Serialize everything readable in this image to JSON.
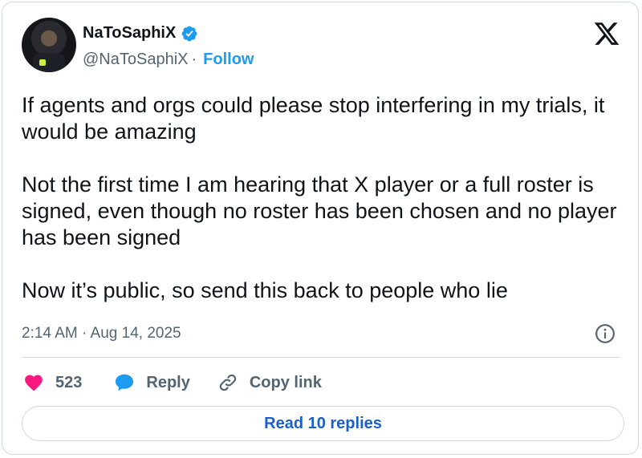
{
  "author": {
    "name": "NaToSaphiX",
    "handle": "@NaToSaphiX",
    "separator": "·",
    "follow_label": "Follow",
    "verified": true
  },
  "tweet": {
    "text": "If agents and orgs could please stop interfering in my trials, it would be amazing\n\nNot the first time I am hearing that X player or a full roster is signed, even though no roster has been chosen and no player has been signed\n\nNow it’s public, so send this back to people who lie",
    "timestamp": "2:14 AM · Aug 14, 2025"
  },
  "actions": {
    "like_count": "523",
    "reply_label": "Reply",
    "copy_link_label": "Copy link"
  },
  "read_replies_label": "Read 10 replies",
  "icons": {
    "verified": "verified-badge-icon",
    "x_logo": "x-logo-icon",
    "info": "info-icon",
    "heart": "heart-icon",
    "reply": "speech-bubble-icon",
    "link": "link-icon"
  },
  "colors": {
    "accent": "#1d9bf0",
    "like": "#f91880",
    "text": "#0f1419",
    "muted": "#536471",
    "border": "#cfd9de"
  }
}
